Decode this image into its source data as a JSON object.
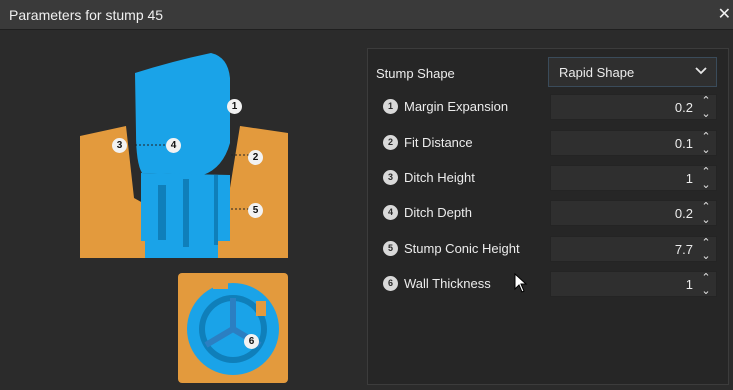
{
  "window": {
    "title": "Parameters for stump 45",
    "close_glyph": "✕"
  },
  "shape": {
    "label": "Stump Shape",
    "value": "Rapid Shape"
  },
  "params": [
    {
      "num": "1",
      "label": "Margin Expansion",
      "value": "0.2"
    },
    {
      "num": "2",
      "label": "Fit Distance",
      "value": "0.1"
    },
    {
      "num": "3",
      "label": "Ditch Height",
      "value": "1"
    },
    {
      "num": "4",
      "label": "Ditch Depth",
      "value": "0.2"
    },
    {
      "num": "5",
      "label": "Stump Conic Height",
      "value": "7.7"
    },
    {
      "num": "6",
      "label": "Wall Thickness",
      "value": "1"
    }
  ],
  "diagram": {
    "callouts": [
      "1",
      "2",
      "3",
      "4",
      "5",
      "6"
    ],
    "colors": {
      "stump": "#1aa3e8",
      "base": "#e39a3d"
    }
  },
  "icons": {
    "close": "close-icon",
    "dropdown": "chevron-down-icon",
    "spin_up": "chevron-up-icon",
    "spin_down": "chevron-down-icon",
    "cursor": "mouse-pointer-icon"
  }
}
